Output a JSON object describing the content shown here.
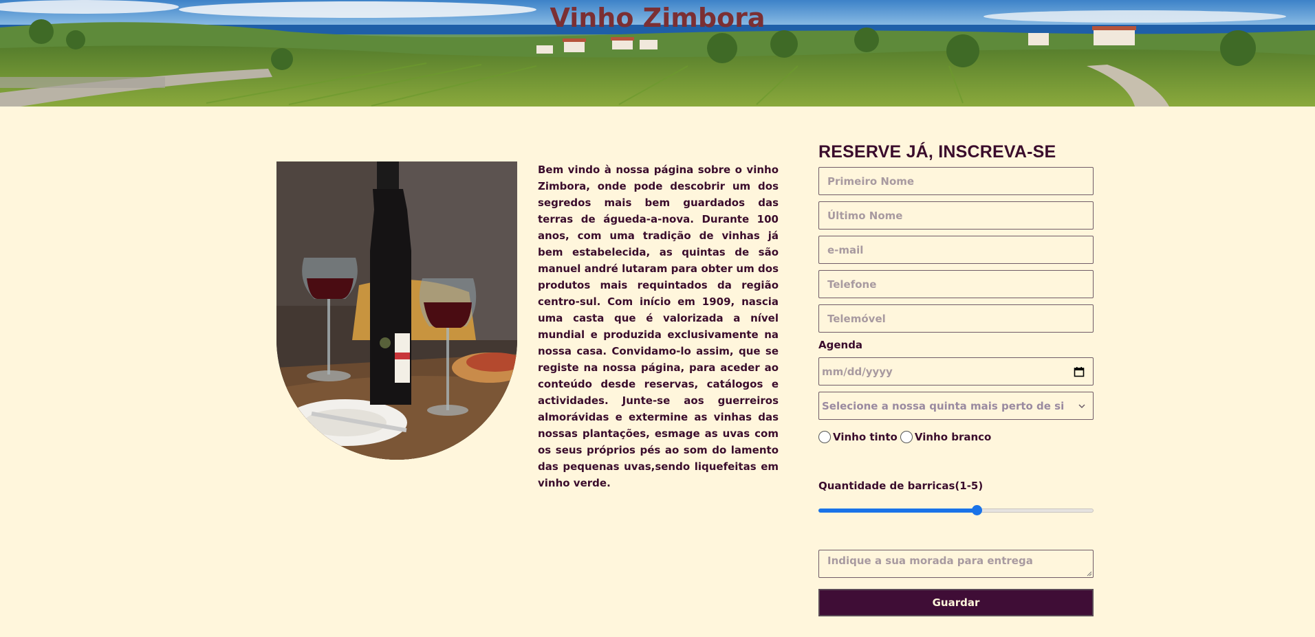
{
  "header": {
    "title": "Vinho Zimbora"
  },
  "intro": {
    "text": "Bem vindo à nossa página sobre o vinho Zimbora, onde pode descobrir um dos segredos mais bem guardados das terras de águeda-a-nova. Durante 100 anos, com uma tradição de vinhas já bem estabelecida, as quintas de são manuel andré lutaram para obter um dos produtos mais requintados da região centro-sul. Com início em 1909, nascia uma casta que é valorizada a nível mundial e produzida exclusivamente na nossa casa. Convidamo-lo assim, que se registe na nossa página, para aceder ao conteúdo desde reservas, catálogos e actividades. Junte-se aos guerreiros almorávidas e extermine as vinhas das nossas plantações, esmage as uvas com os seus próprios pés ao som do lamento das pequenas uvas,sendo liquefeitas em vinho verde."
  },
  "form": {
    "title": "RESERVE JÁ, INSCREVA-SE",
    "first_name_placeholder": "Primeiro Nome",
    "last_name_placeholder": "Último Nome",
    "email_placeholder": "e-mail",
    "phone_placeholder": "Telefone",
    "mobile_placeholder": "Telemóvel",
    "agenda_label": "Agenda",
    "date_placeholder": "mm/dd/yyyy",
    "select_value": "Selecione a nossa quinta mais perto de si",
    "radio_options": [
      "Vinho tinto",
      "Vinho branco"
    ],
    "range_label": "Quantidade de barricas(1-5)",
    "range_value": 3.3,
    "range_min": 1,
    "range_max": 5,
    "address_placeholder": "Indique a sua morada para entrega",
    "submit_label": "Guardar"
  },
  "colors": {
    "background": "#fff6dc",
    "title": "#7b2f33",
    "text": "#3a0c2c",
    "button": "#3f0d36",
    "accent": "#1a73e8"
  },
  "icons": {
    "date": "calendar-icon",
    "select": "chevron-down-icon"
  }
}
